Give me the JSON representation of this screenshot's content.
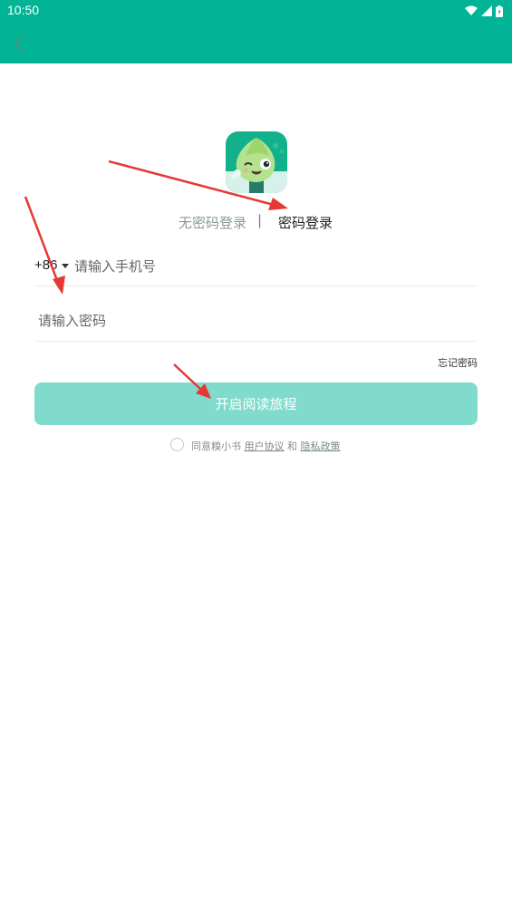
{
  "status_bar": {
    "time": "10:50"
  },
  "tabs": {
    "passwordless": "无密码登录",
    "separator": "|",
    "password": "密码登录"
  },
  "phone": {
    "country_code": "+86",
    "placeholder": "请输入手机号"
  },
  "password": {
    "placeholder": "请输入密码"
  },
  "forgot_password": "忘记密码",
  "submit_label": "开启阅读旅程",
  "agreement": {
    "prefix": "同意糗小书",
    "user_agreement": "用户协议",
    "and": "和",
    "privacy_policy": "隐私政策"
  },
  "colors": {
    "brand": "#00b495",
    "button": "#80dbcc",
    "annotation": "#e53935"
  }
}
